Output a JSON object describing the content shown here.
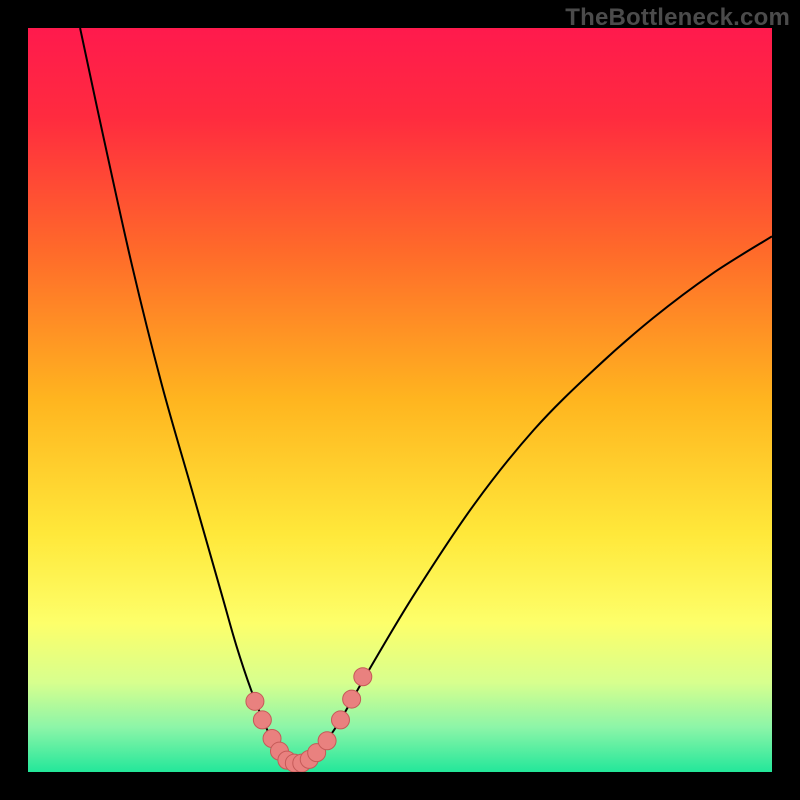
{
  "watermark": "TheBottleneck.com",
  "colors": {
    "frame": "#000000",
    "gradient_stops": [
      {
        "offset": 0.0,
        "color": "#ff1a4d"
      },
      {
        "offset": 0.12,
        "color": "#ff2b3f"
      },
      {
        "offset": 0.3,
        "color": "#ff6a2a"
      },
      {
        "offset": 0.5,
        "color": "#ffb51f"
      },
      {
        "offset": 0.68,
        "color": "#ffe83a"
      },
      {
        "offset": 0.8,
        "color": "#fdff6a"
      },
      {
        "offset": 0.88,
        "color": "#d7ff8e"
      },
      {
        "offset": 0.94,
        "color": "#8cf5a8"
      },
      {
        "offset": 1.0,
        "color": "#23e79a"
      }
    ],
    "curve": "#000000",
    "marker_fill": "#e9817f",
    "marker_stroke": "#c55a58"
  },
  "chart_data": {
    "type": "line",
    "title": "",
    "xlabel": "",
    "ylabel": "",
    "xlim": [
      0,
      100
    ],
    "ylim": [
      0,
      100
    ],
    "series": [
      {
        "name": "bottleneck-curve",
        "x": [
          7,
          10,
          14,
          18,
          22,
          26,
          28,
          30,
          32,
          33,
          34,
          35,
          36,
          37,
          38,
          39,
          40,
          42,
          46,
          52,
          60,
          68,
          76,
          84,
          92,
          100
        ],
        "values": [
          100,
          86,
          68,
          52,
          38,
          24,
          17,
          11,
          6,
          4,
          2.5,
          1.7,
          1.2,
          1.2,
          1.7,
          2.6,
          4,
          7,
          14,
          24,
          36,
          46,
          54,
          61,
          67,
          72
        ]
      }
    ],
    "markers": {
      "name": "highlight-points",
      "x": [
        30.5,
        31.5,
        32.8,
        33.8,
        34.8,
        35.8,
        36.8,
        37.8,
        38.8,
        40.2,
        42.0,
        43.5,
        45.0
      ],
      "values": [
        9.5,
        7.0,
        4.5,
        2.8,
        1.6,
        1.2,
        1.2,
        1.7,
        2.6,
        4.2,
        7.0,
        9.8,
        12.8
      ],
      "radius": 9
    }
  }
}
